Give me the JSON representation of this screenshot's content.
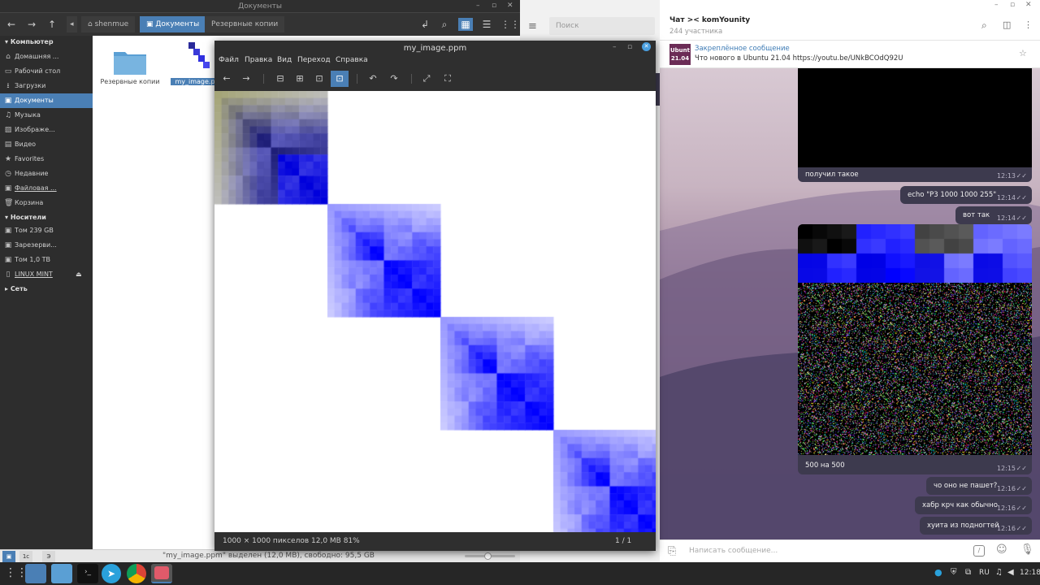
{
  "file_manager": {
    "window_title": "Документы",
    "breadcrumbs": [
      "shenmue",
      "Документы",
      "Резервные копии"
    ],
    "sidebar": {
      "computer_label": "Компьютер",
      "computer_items": [
        {
          "label": "Домашняя ...",
          "icon": "home-icon"
        },
        {
          "label": "Рабочий стол",
          "icon": "desktop-icon"
        },
        {
          "label": "Загрузки",
          "icon": "download-icon"
        },
        {
          "label": "Документы",
          "icon": "folder-icon"
        },
        {
          "label": "Музыка",
          "icon": "music-icon"
        },
        {
          "label": "Изображе...",
          "icon": "image-icon"
        },
        {
          "label": "Видео",
          "icon": "video-icon"
        },
        {
          "label": "Favorites",
          "icon": "star-icon"
        },
        {
          "label": "Недавние",
          "icon": "clock-icon"
        },
        {
          "label": "Файловая ...",
          "icon": "drive-icon"
        },
        {
          "label": "Корзина",
          "icon": "trash-icon"
        }
      ],
      "devices_label": "Носители",
      "device_items": [
        {
          "label": "Том 239 GB",
          "icon": "drive-icon"
        },
        {
          "label": "Зарезерви...",
          "icon": "drive-icon"
        },
        {
          "label": "Том 1,0 TB",
          "icon": "drive-icon"
        },
        {
          "label": "LINUX MINT",
          "icon": "usb-icon"
        }
      ],
      "network_label": "Сеть"
    },
    "files": [
      {
        "name": "Резервные копии",
        "type": "folder"
      },
      {
        "name": "my_image.p",
        "type": "image",
        "selected": true
      }
    ],
    "status_text": "\"my_image.ppm\" выделен (12,0 MB), свободно: 95,5 GB",
    "status_buttons": [
      "1c",
      "Э"
    ]
  },
  "image_viewer": {
    "title": "my_image.ppm",
    "menu": [
      "Файл",
      "Правка",
      "Вид",
      "Переход",
      "Справка"
    ],
    "status_left": "1000 × 1000 пикселов   12,0 MB   81%",
    "status_right": "1 / 1"
  },
  "telegram": {
    "search_placeholder": "Поиск",
    "chat_name": "Чат >< komYounity",
    "members": "244 участника",
    "pinned_title": "Закреплённое сообщение",
    "pinned_text": "Что нового в Ubuntu 21.04  https://youtu.be/UNkBCOdQ92U",
    "pinned_thumb_line1": "Ubunt",
    "pinned_thumb_line2": "21.04",
    "messages": [
      {
        "text": "получил такое",
        "time": "12:13"
      },
      {
        "text": "echo \"P3 1000 1000 255\"",
        "time": "12:14"
      },
      {
        "text": "вот так",
        "time": "12:14"
      },
      {
        "text": "500 на 500",
        "time": "12:15"
      },
      {
        "text": "чо оно не пашет?",
        "time": "12:16"
      },
      {
        "text": "хабр крч как обычно",
        "time": "12:16"
      },
      {
        "text": "хуита из подногтей",
        "time": "12:16"
      }
    ],
    "input_placeholder": "Написать сообщение..."
  },
  "taskbar": {
    "language": "RU",
    "clock": "12:18"
  },
  "colors": {
    "accent": "#4a7fb5",
    "bubble": "#3d3a4e",
    "viewer_bg": "#2f2f2f"
  }
}
